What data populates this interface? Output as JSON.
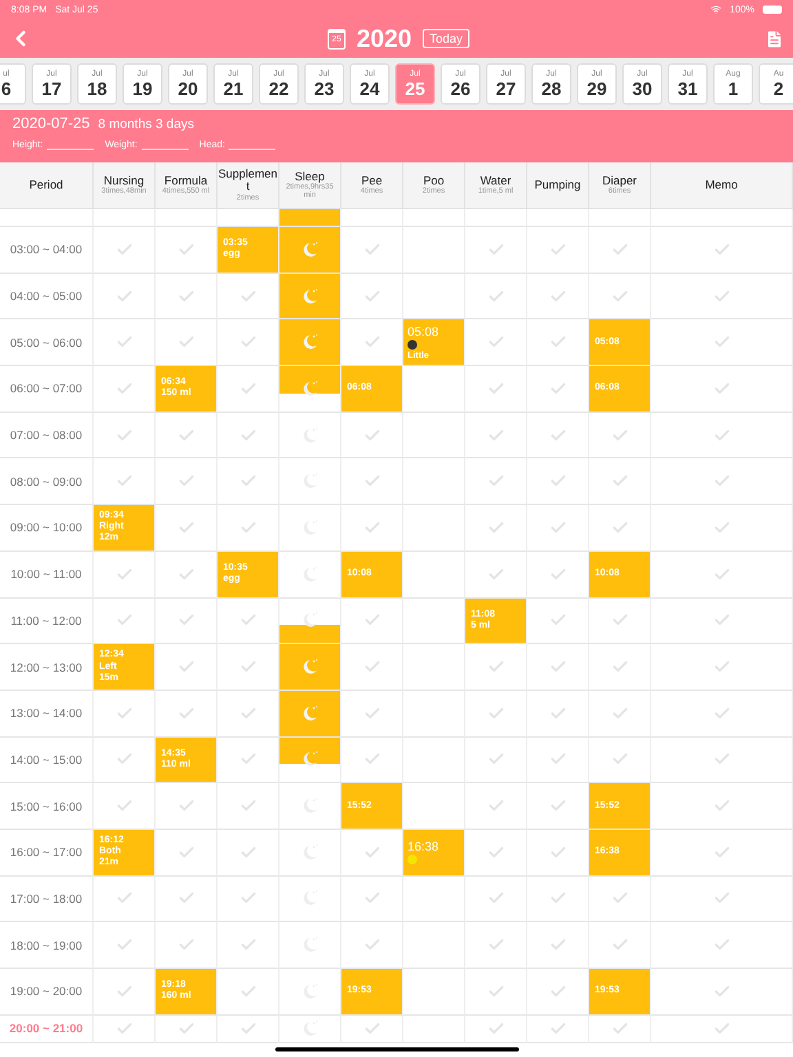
{
  "status_bar": {
    "time": "8:08 PM",
    "date": "Sat Jul 25",
    "battery": "100%"
  },
  "header": {
    "year": "2020",
    "today_button": "Today",
    "calendar_day": "25"
  },
  "date_strip": [
    {
      "month": "ul",
      "day": "6",
      "selected": false
    },
    {
      "month": "Jul",
      "day": "17",
      "selected": false
    },
    {
      "month": "Jul",
      "day": "18",
      "selected": false
    },
    {
      "month": "Jul",
      "day": "19",
      "selected": false
    },
    {
      "month": "Jul",
      "day": "20",
      "selected": false
    },
    {
      "month": "Jul",
      "day": "21",
      "selected": false
    },
    {
      "month": "Jul",
      "day": "22",
      "selected": false
    },
    {
      "month": "Jul",
      "day": "23",
      "selected": false
    },
    {
      "month": "Jul",
      "day": "24",
      "selected": false
    },
    {
      "month": "Jul",
      "day": "25",
      "selected": true
    },
    {
      "month": "Jul",
      "day": "26",
      "selected": false
    },
    {
      "month": "Jul",
      "day": "27",
      "selected": false
    },
    {
      "month": "Jul",
      "day": "28",
      "selected": false
    },
    {
      "month": "Jul",
      "day": "29",
      "selected": false
    },
    {
      "month": "Jul",
      "day": "30",
      "selected": false
    },
    {
      "month": "Jul",
      "day": "31",
      "selected": false
    },
    {
      "month": "Aug",
      "day": "1",
      "selected": false
    },
    {
      "month": "Au",
      "day": "2",
      "selected": false
    }
  ],
  "info": {
    "date": "2020-07-25",
    "age": "8 months 3 days",
    "fields": [
      {
        "label": "Height:"
      },
      {
        "label": "Weight:"
      },
      {
        "label": "Head:"
      }
    ]
  },
  "columns": [
    {
      "title": "Period"
    },
    {
      "title": "Nursing",
      "summary": "3times,48min"
    },
    {
      "title": "Formula",
      "summary": "4times,550 ml"
    },
    {
      "title": "Supplement",
      "summary": "2times"
    },
    {
      "title": "Sleep",
      "summary": "2times,9hrs35 min"
    },
    {
      "title": "Pee",
      "summary": "4times"
    },
    {
      "title": "Poo",
      "summary": "2times"
    },
    {
      "title": "Water",
      "summary": "1time,5 ml"
    },
    {
      "title": "Pumping"
    },
    {
      "title": "Diaper",
      "summary": "6times"
    },
    {
      "title": "Memo"
    }
  ],
  "rows": [
    {
      "cells": [
        {
          "kind": "blank"
        },
        {
          "kind": "blank"
        },
        {
          "kind": "blank"
        },
        {
          "kind": "asleep"
        },
        {
          "kind": "blank"
        },
        {
          "kind": "blank"
        },
        {
          "kind": "blank"
        },
        {
          "kind": "blank"
        },
        {
          "kind": "blank"
        },
        {
          "kind": "blank"
        }
      ]
    },
    {
      "period": "03:00 ~ 04:00",
      "current": false,
      "cells": [
        {
          "kind": "check"
        },
        {
          "kind": "check"
        },
        {
          "kind": "entry",
          "lines": [
            "03:35",
            "egg"
          ]
        },
        {
          "kind": "asleep"
        },
        {
          "kind": "check"
        },
        {
          "kind": "empty"
        },
        {
          "kind": "check"
        },
        {
          "kind": "check"
        },
        {
          "kind": "check"
        },
        {
          "kind": "check"
        }
      ]
    },
    {
      "period": "04:00 ~ 05:00",
      "current": false,
      "cells": [
        {
          "kind": "check"
        },
        {
          "kind": "check"
        },
        {
          "kind": "check"
        },
        {
          "kind": "asleep"
        },
        {
          "kind": "check"
        },
        {
          "kind": "empty"
        },
        {
          "kind": "check"
        },
        {
          "kind": "check"
        },
        {
          "kind": "check"
        },
        {
          "kind": "check"
        }
      ]
    },
    {
      "period": "05:00 ~ 06:00",
      "current": false,
      "cells": [
        {
          "kind": "check"
        },
        {
          "kind": "check"
        },
        {
          "kind": "check"
        },
        {
          "kind": "asleep"
        },
        {
          "kind": "check"
        },
        {
          "kind": "poo",
          "time": "05:08",
          "color": "#333333",
          "note": "Little"
        },
        {
          "kind": "check"
        },
        {
          "kind": "check"
        },
        {
          "kind": "entry",
          "lines": [
            "05:08"
          ]
        },
        {
          "kind": "check"
        }
      ]
    },
    {
      "period": "06:00 ~ 07:00",
      "current": false,
      "cells": [
        {
          "kind": "check"
        },
        {
          "kind": "entry",
          "lines": [
            "06:34",
            "150 ml"
          ]
        },
        {
          "kind": "check"
        },
        {
          "kind": "wake_up"
        },
        {
          "kind": "entry",
          "lines": [
            "06:08"
          ]
        },
        {
          "kind": "empty"
        },
        {
          "kind": "check"
        },
        {
          "kind": "check"
        },
        {
          "kind": "entry",
          "lines": [
            "06:08"
          ]
        },
        {
          "kind": "check"
        }
      ]
    },
    {
      "period": "07:00 ~ 08:00",
      "current": false,
      "cells": [
        {
          "kind": "check"
        },
        {
          "kind": "check"
        },
        {
          "kind": "check"
        },
        {
          "kind": "sleep"
        },
        {
          "kind": "check"
        },
        {
          "kind": "empty"
        },
        {
          "kind": "check"
        },
        {
          "kind": "check"
        },
        {
          "kind": "check"
        },
        {
          "kind": "check"
        }
      ]
    },
    {
      "period": "08:00 ~ 09:00",
      "current": false,
      "cells": [
        {
          "kind": "check"
        },
        {
          "kind": "check"
        },
        {
          "kind": "check"
        },
        {
          "kind": "sleep"
        },
        {
          "kind": "check"
        },
        {
          "kind": "empty"
        },
        {
          "kind": "check"
        },
        {
          "kind": "check"
        },
        {
          "kind": "check"
        },
        {
          "kind": "check"
        }
      ]
    },
    {
      "period": "09:00 ~ 10:00",
      "current": false,
      "cells": [
        {
          "kind": "entry",
          "lines": [
            "09:34",
            "Right",
            "12m"
          ]
        },
        {
          "kind": "check"
        },
        {
          "kind": "check"
        },
        {
          "kind": "sleep"
        },
        {
          "kind": "check"
        },
        {
          "kind": "empty"
        },
        {
          "kind": "check"
        },
        {
          "kind": "check"
        },
        {
          "kind": "check"
        },
        {
          "kind": "check"
        }
      ]
    },
    {
      "period": "10:00 ~ 11:00",
      "current": false,
      "cells": [
        {
          "kind": "check"
        },
        {
          "kind": "check"
        },
        {
          "kind": "entry",
          "lines": [
            "10:35",
            "egg"
          ]
        },
        {
          "kind": "sleep"
        },
        {
          "kind": "entry",
          "lines": [
            "10:08"
          ]
        },
        {
          "kind": "empty"
        },
        {
          "kind": "check"
        },
        {
          "kind": "check"
        },
        {
          "kind": "entry",
          "lines": [
            "10:08"
          ]
        },
        {
          "kind": "check"
        }
      ]
    },
    {
      "period": "11:00 ~ 12:00",
      "current": false,
      "cells": [
        {
          "kind": "check"
        },
        {
          "kind": "check"
        },
        {
          "kind": "check"
        },
        {
          "kind": "fall_asleep"
        },
        {
          "kind": "check"
        },
        {
          "kind": "empty"
        },
        {
          "kind": "entry",
          "lines": [
            "11:08",
            "5 ml"
          ]
        },
        {
          "kind": "check"
        },
        {
          "kind": "check"
        },
        {
          "kind": "check"
        }
      ]
    },
    {
      "period": "12:00 ~ 13:00",
      "current": false,
      "cells": [
        {
          "kind": "entry",
          "lines": [
            "12:34",
            "Left",
            "15m"
          ]
        },
        {
          "kind": "check"
        },
        {
          "kind": "check"
        },
        {
          "kind": "asleep"
        },
        {
          "kind": "check"
        },
        {
          "kind": "empty"
        },
        {
          "kind": "check"
        },
        {
          "kind": "check"
        },
        {
          "kind": "check"
        },
        {
          "kind": "check"
        }
      ]
    },
    {
      "period": "13:00 ~ 14:00",
      "current": false,
      "cells": [
        {
          "kind": "check"
        },
        {
          "kind": "check"
        },
        {
          "kind": "check"
        },
        {
          "kind": "asleep"
        },
        {
          "kind": "check"
        },
        {
          "kind": "empty"
        },
        {
          "kind": "check"
        },
        {
          "kind": "check"
        },
        {
          "kind": "check"
        },
        {
          "kind": "check"
        }
      ]
    },
    {
      "period": "14:00 ~ 15:00",
      "current": false,
      "cells": [
        {
          "kind": "check"
        },
        {
          "kind": "entry",
          "lines": [
            "14:35",
            "110 ml"
          ]
        },
        {
          "kind": "check"
        },
        {
          "kind": "wake_up"
        },
        {
          "kind": "check"
        },
        {
          "kind": "empty"
        },
        {
          "kind": "check"
        },
        {
          "kind": "check"
        },
        {
          "kind": "check"
        },
        {
          "kind": "check"
        }
      ]
    },
    {
      "period": "15:00 ~ 16:00",
      "current": false,
      "cells": [
        {
          "kind": "check"
        },
        {
          "kind": "check"
        },
        {
          "kind": "check"
        },
        {
          "kind": "sleep"
        },
        {
          "kind": "entry",
          "lines": [
            "15:52"
          ]
        },
        {
          "kind": "empty"
        },
        {
          "kind": "check"
        },
        {
          "kind": "check"
        },
        {
          "kind": "entry",
          "lines": [
            "15:52"
          ]
        },
        {
          "kind": "check"
        }
      ]
    },
    {
      "period": "16:00 ~ 17:00",
      "current": false,
      "cells": [
        {
          "kind": "entry",
          "lines": [
            "16:12",
            "Both",
            "21m"
          ]
        },
        {
          "kind": "check"
        },
        {
          "kind": "check"
        },
        {
          "kind": "sleep"
        },
        {
          "kind": "check"
        },
        {
          "kind": "poo",
          "time": "16:38",
          "color": "#f2e600"
        },
        {
          "kind": "check"
        },
        {
          "kind": "check"
        },
        {
          "kind": "entry",
          "lines": [
            "16:38"
          ]
        },
        {
          "kind": "check"
        }
      ]
    },
    {
      "period": "17:00 ~ 18:00",
      "current": false,
      "cells": [
        {
          "kind": "check"
        },
        {
          "kind": "check"
        },
        {
          "kind": "check"
        },
        {
          "kind": "sleep"
        },
        {
          "kind": "check"
        },
        {
          "kind": "empty"
        },
        {
          "kind": "check"
        },
        {
          "kind": "check"
        },
        {
          "kind": "check"
        },
        {
          "kind": "check"
        }
      ]
    },
    {
      "period": "18:00 ~ 19:00",
      "current": false,
      "cells": [
        {
          "kind": "check"
        },
        {
          "kind": "check"
        },
        {
          "kind": "check"
        },
        {
          "kind": "sleep"
        },
        {
          "kind": "check"
        },
        {
          "kind": "empty"
        },
        {
          "kind": "check"
        },
        {
          "kind": "check"
        },
        {
          "kind": "check"
        },
        {
          "kind": "check"
        }
      ]
    },
    {
      "period": "19:00 ~ 20:00",
      "current": false,
      "cells": [
        {
          "kind": "check"
        },
        {
          "kind": "entry",
          "lines": [
            "19:18",
            "160 ml"
          ]
        },
        {
          "kind": "check"
        },
        {
          "kind": "sleep"
        },
        {
          "kind": "entry",
          "lines": [
            "19:53"
          ]
        },
        {
          "kind": "empty"
        },
        {
          "kind": "check"
        },
        {
          "kind": "check"
        },
        {
          "kind": "entry",
          "lines": [
            "19:53"
          ]
        },
        {
          "kind": "check"
        }
      ]
    },
    {
      "period": "20:00 ~ 21:00",
      "current": true,
      "cells": [
        {
          "kind": "check"
        },
        {
          "kind": "check"
        },
        {
          "kind": "check"
        },
        {
          "kind": "sleep"
        },
        {
          "kind": "check"
        },
        {
          "kind": "empty"
        },
        {
          "kind": "check"
        },
        {
          "kind": "check"
        },
        {
          "kind": "check"
        },
        {
          "kind": "check"
        }
      ]
    }
  ]
}
